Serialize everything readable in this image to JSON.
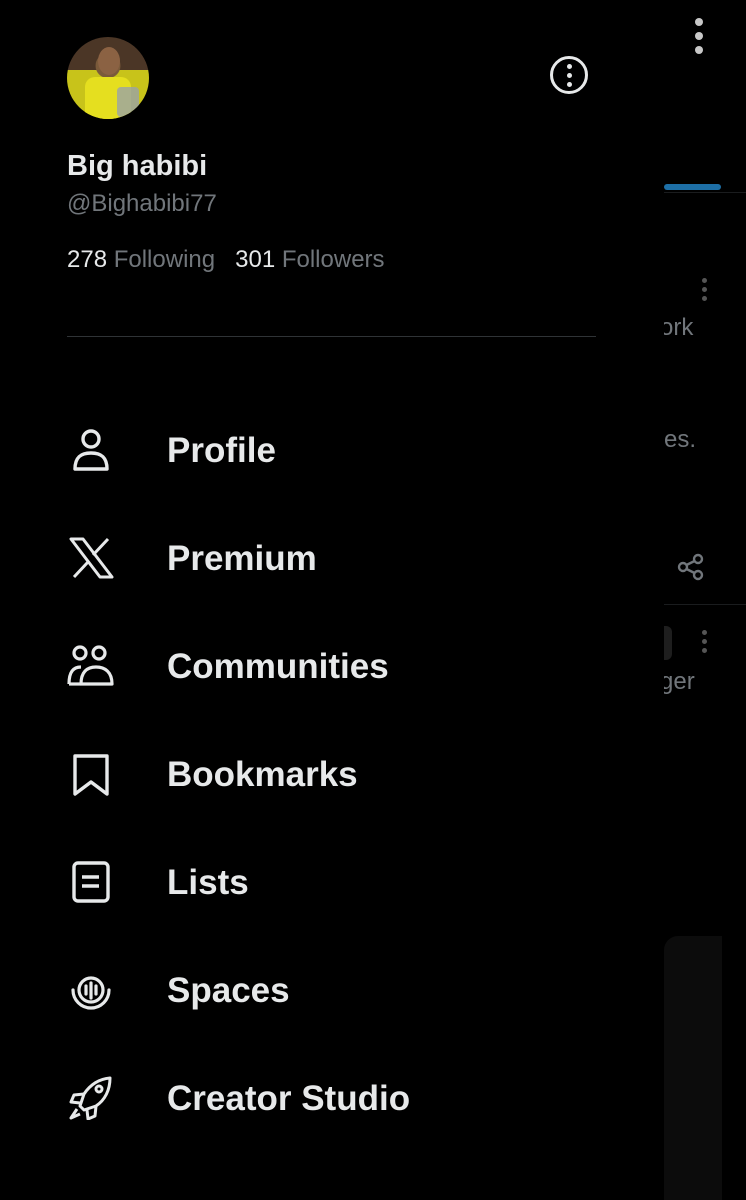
{
  "profile": {
    "name": "Big habibi",
    "handle": "@Bighabibi77",
    "following_count": "278",
    "following_label": "Following",
    "followers_count": "301",
    "followers_label": "Followers"
  },
  "menu": [
    {
      "label": "Profile",
      "icon": "person-icon"
    },
    {
      "label": "Premium",
      "icon": "x-logo-icon"
    },
    {
      "label": "Communities",
      "icon": "people-icon"
    },
    {
      "label": "Bookmarks",
      "icon": "bookmark-icon"
    },
    {
      "label": "Lists",
      "icon": "list-icon"
    },
    {
      "label": "Spaces",
      "icon": "microphone-icon"
    },
    {
      "label": "Creator Studio",
      "icon": "rocket-icon"
    }
  ],
  "background": {
    "snippets": [
      "ork",
      "es.",
      "ger"
    ],
    "accent_color": "#1d6fa6"
  }
}
